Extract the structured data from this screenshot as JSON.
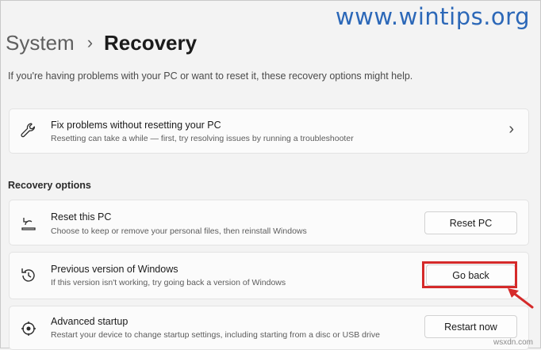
{
  "watermark": "www.wintips.org",
  "breadcrumb": {
    "parent": "System",
    "separator": "›",
    "current": "Recovery"
  },
  "intro": "If you're having problems with your PC or want to reset it, these recovery options might help.",
  "troubleshoot": {
    "icon": "wrench-icon",
    "title": "Fix problems without resetting your PC",
    "description": "Resetting can take a while — first, try resolving issues by running a troubleshooter",
    "chevron": "›"
  },
  "section": {
    "label": "Recovery options"
  },
  "options": [
    {
      "icon": "reset-pc-icon",
      "title": "Reset this PC",
      "description": "Choose to keep or remove your personal files, then reinstall Windows",
      "button": "Reset PC"
    },
    {
      "icon": "history-icon",
      "title": "Previous version of Windows",
      "description": "If this version isn't working, try going back a version of Windows",
      "button": "Go back"
    },
    {
      "icon": "advanced-startup-icon",
      "title": "Advanced startup",
      "description": "Restart your device to change startup settings, including starting from a disc or USB drive",
      "button": "Restart now"
    }
  ],
  "footer_watermark": "wsxdn.com",
  "colors": {
    "highlight": "#d52a2a",
    "watermark": "#2c68b8"
  }
}
